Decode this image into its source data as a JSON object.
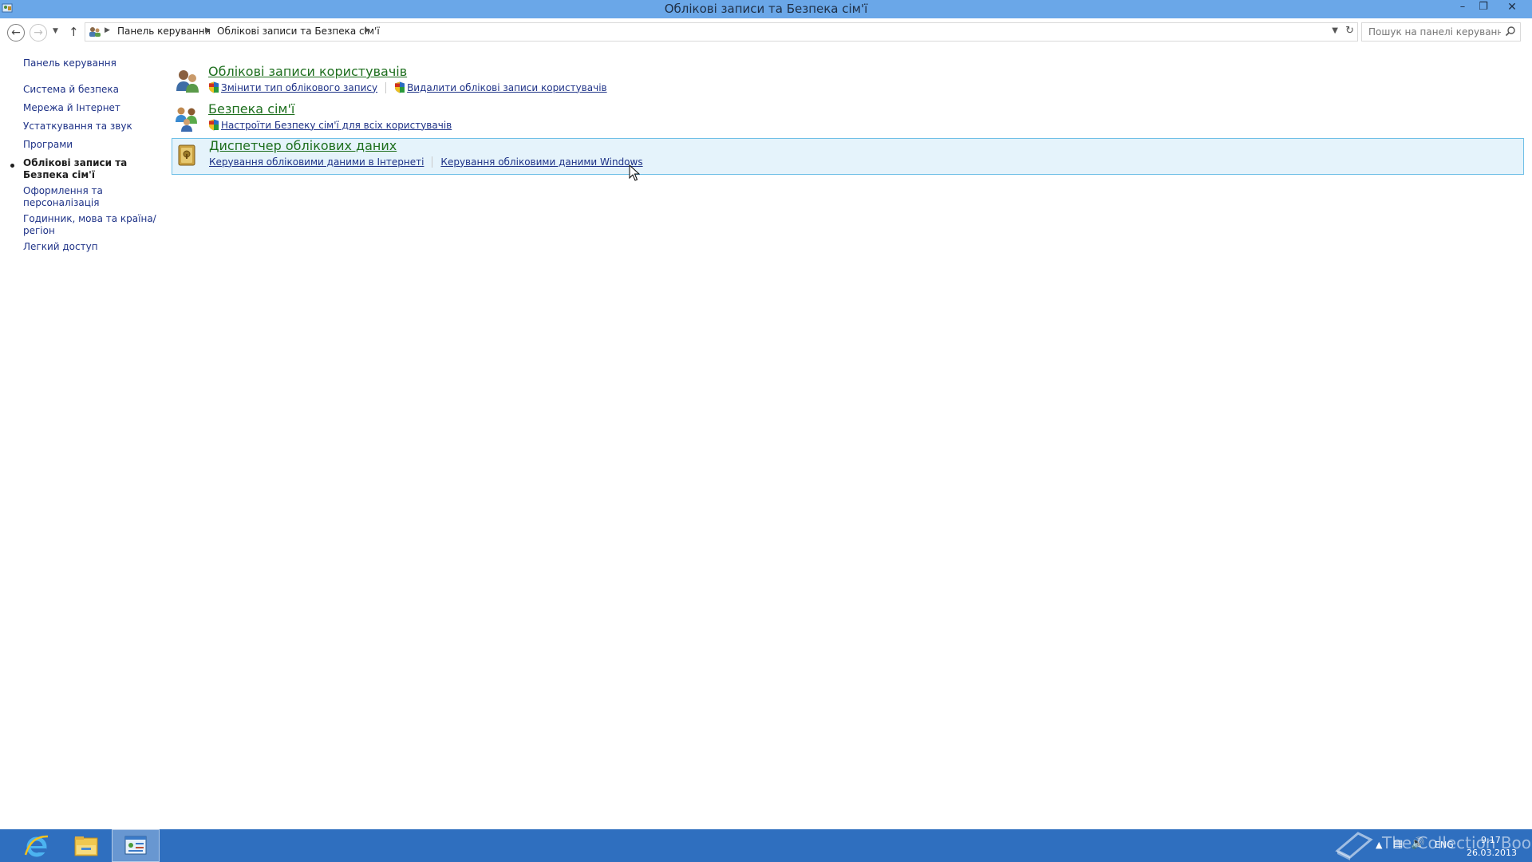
{
  "window": {
    "title": "Облікові записи та Безпека сім'ї",
    "minimize": "–",
    "maximize": "❐",
    "close": "✕"
  },
  "address": {
    "crumbs": [
      "Панель керування",
      "Облікові записи та Безпека сім'ї"
    ],
    "search_placeholder": "Пошук на панелі керування"
  },
  "sidebar": {
    "home": "Панель керування",
    "items": [
      {
        "label": "Система й безпека"
      },
      {
        "label": "Мережа й Інтернет"
      },
      {
        "label": "Устаткування та звук"
      },
      {
        "label": "Програми"
      },
      {
        "label": "Облікові записи та Безпека сім'ї",
        "active": true
      },
      {
        "label": "Оформлення та персоналізація"
      },
      {
        "label": "Годинник, мова та країна/регіон"
      },
      {
        "label": "Легкий доступ"
      }
    ]
  },
  "categories": [
    {
      "title": "Облікові записи користувачів",
      "icon": "users-icon",
      "links": [
        {
          "label": "Змінити тип облікового запису",
          "shield": true
        },
        {
          "label": "Видалити облікові записи користувачів",
          "shield": true
        }
      ]
    },
    {
      "title": "Безпека сім'ї",
      "icon": "family-safety-icon",
      "links": [
        {
          "label": "Настроїти Безпеку сім'ї для всіх користувачів",
          "shield": true
        }
      ]
    },
    {
      "title": "Диспетчер облікових даних",
      "icon": "credential-manager-icon",
      "hovered": true,
      "links": [
        {
          "label": "Керування обліковими даними в Інтернеті",
          "shield": false
        },
        {
          "label": "Керування обліковими даними Windows",
          "shield": false
        }
      ]
    }
  ],
  "taskbar": {
    "items": [
      "internet-explorer-icon",
      "file-explorer-icon",
      "control-panel-icon"
    ],
    "tray": {
      "language": "ENG",
      "time": "9:17",
      "date": "26.03.2013"
    },
    "watermark": "The Collection Book"
  },
  "colors": {
    "titlebar": "#6aa7e8",
    "taskbar": "#2f6fbf",
    "category_title": "#1e6f1e",
    "link": "#1e3287",
    "hover_bg": "#e5f3fb",
    "hover_border": "#70c0e7"
  }
}
